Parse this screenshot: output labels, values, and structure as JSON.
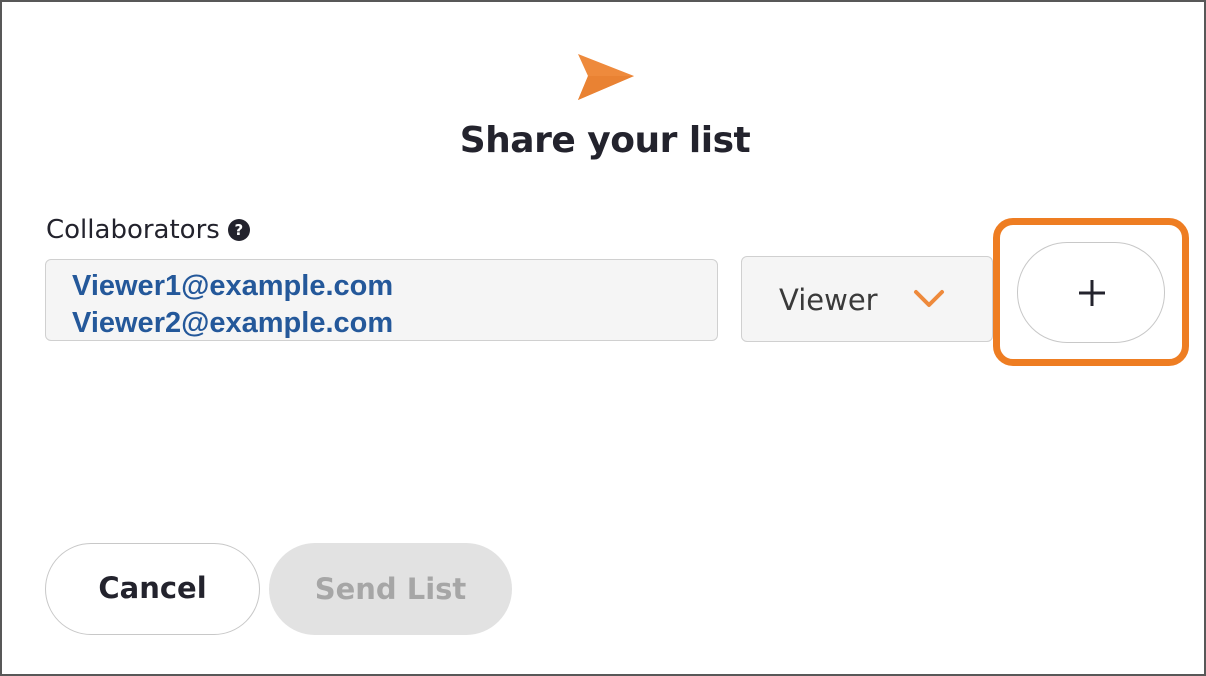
{
  "dialog": {
    "title": "Share your list",
    "icon": "send-icon",
    "accent_color": "#EE7D22"
  },
  "collaborators": {
    "label": "Collaborators",
    "help_icon": "question-circle-icon",
    "help_glyph": "?",
    "emails": [
      "Viewer1@example.com",
      "Viewer2@example.com"
    ],
    "email_color": "#24589A"
  },
  "role_select": {
    "selected": "Viewer",
    "icon": "chevron-down-icon"
  },
  "add_button": {
    "icon": "plus-icon",
    "highlighted": true,
    "highlight_color": "#EE7D22"
  },
  "footer": {
    "cancel_label": "Cancel",
    "send_label": "Send List",
    "send_disabled": true
  }
}
